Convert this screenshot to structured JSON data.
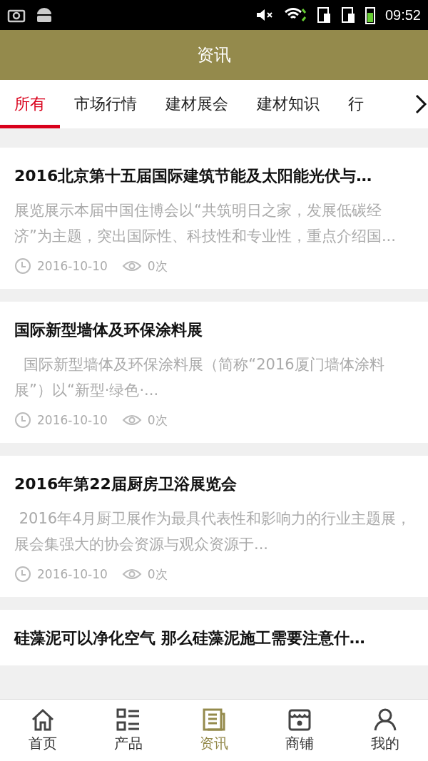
{
  "status_bar": {
    "time": "09:52"
  },
  "header": {
    "title": "资讯"
  },
  "tabs": [
    {
      "label": "所有",
      "selected": true
    },
    {
      "label": "市场行情",
      "selected": false
    },
    {
      "label": "建材展会",
      "selected": false
    },
    {
      "label": "建材知识",
      "selected": false
    },
    {
      "label": "行",
      "selected": false
    }
  ],
  "articles": [
    {
      "title": "2016北京第十五届国际建筑节能及太阳能光伏与…",
      "summary": "展览展示本届中国住博会以“共筑明日之家，发展低碳经济”为主题，突出国际性、科技性和专业性，重点介绍国...",
      "date": "2016-10-10",
      "views": "0次"
    },
    {
      "title": "国际新型墙体及环保涂料展",
      "summary": "  国际新型墙体及环保涂料展（简称“2016厦门墙体涂料展”）以“新型·绿色·...",
      "date": "2016-10-10",
      "views": "0次"
    },
    {
      "title": "2016年第22届厨房卫浴展览会",
      "summary": " 2016年4月厨卫展作为最具代表性和影响力的行业主题展，展会集强大的协会资源与观众资源于...",
      "date": "2016-10-10",
      "views": "0次"
    },
    {
      "title": "硅藻泥可以净化空气 那么硅藻泥施工需要注意什…"
    }
  ],
  "bottom_nav": [
    {
      "kind": "home",
      "label": "首页",
      "selected": false
    },
    {
      "kind": "products",
      "label": "产品",
      "selected": false
    },
    {
      "kind": "news",
      "label": "资讯",
      "selected": true
    },
    {
      "kind": "shop",
      "label": "商铺",
      "selected": false
    },
    {
      "kind": "profile",
      "label": "我的",
      "selected": false
    }
  ]
}
